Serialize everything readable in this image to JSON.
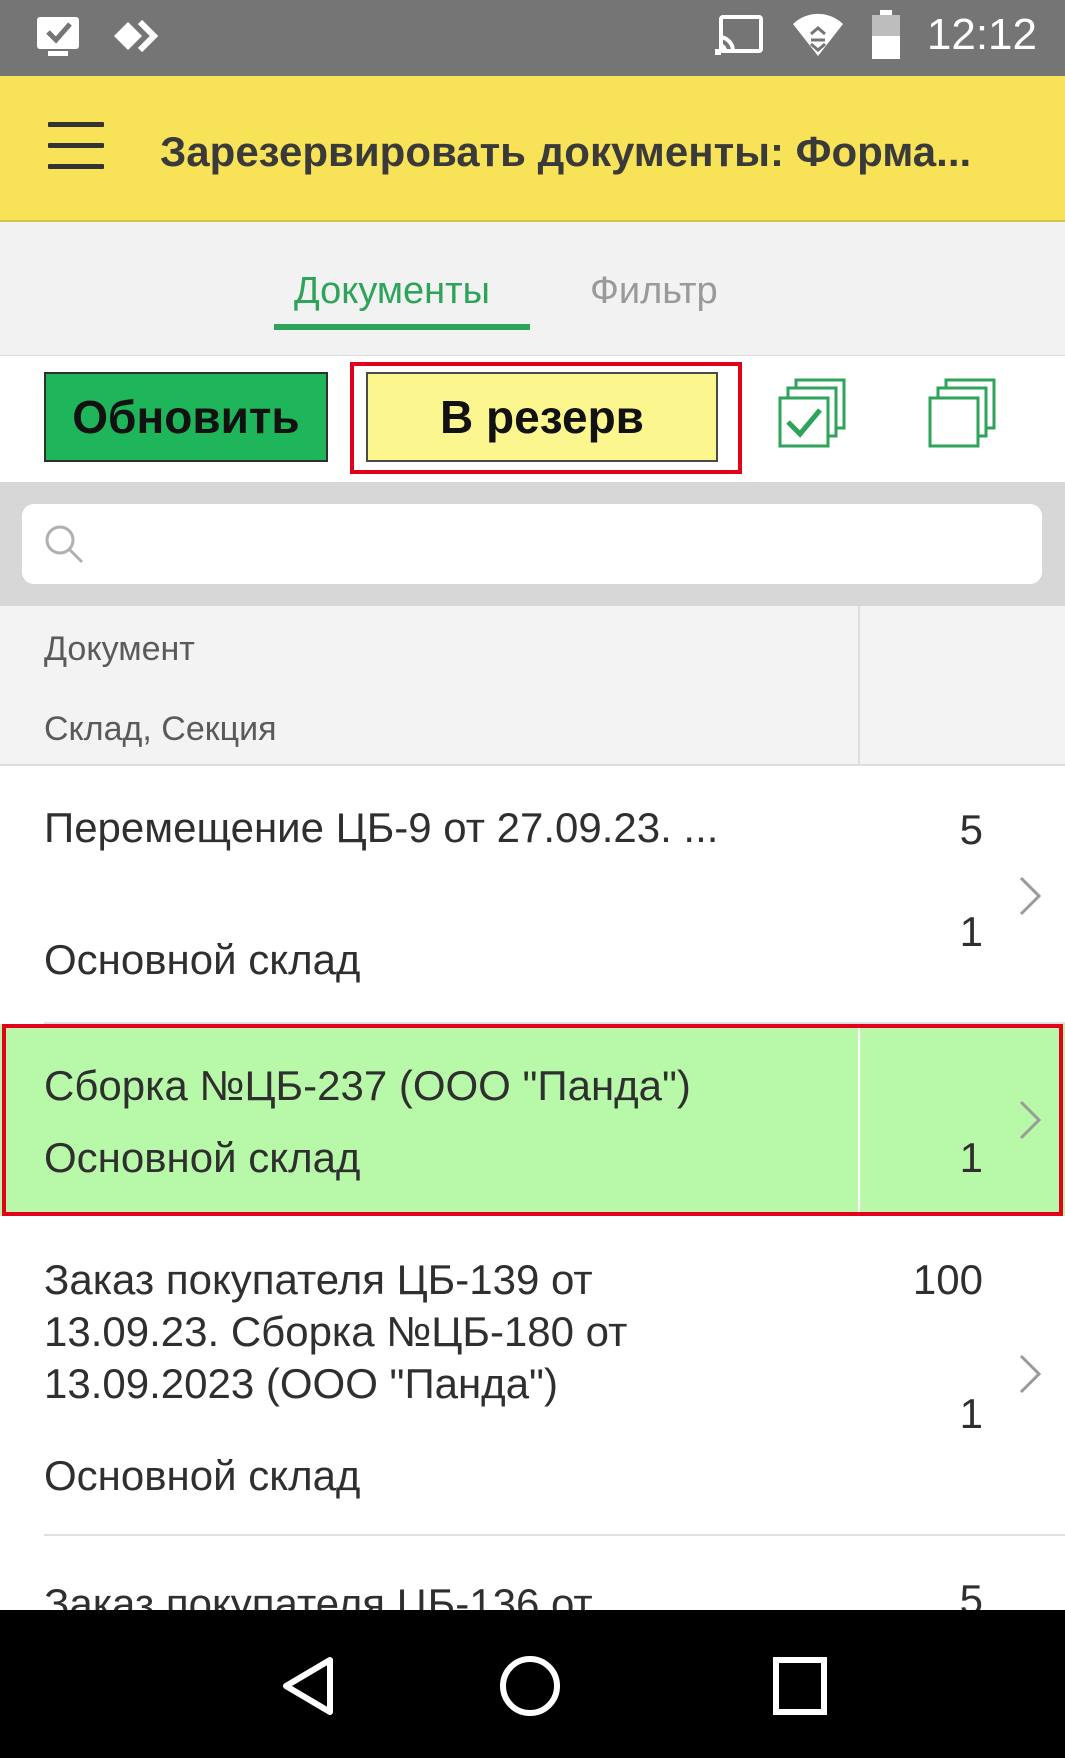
{
  "status_bar": {
    "time": "12:12"
  },
  "header": {
    "title": "Зарезервировать документы: Форма..."
  },
  "tabs": [
    {
      "label": "Документы",
      "active": true
    },
    {
      "label": "Фильтр",
      "active": false
    }
  ],
  "toolbar": {
    "refresh_label": "Обновить",
    "reserve_label": "В резерв"
  },
  "search": {
    "value": "",
    "placeholder": ""
  },
  "table": {
    "headers": {
      "line1": "Документ",
      "line2": "Склад, Секция"
    },
    "rows": [
      {
        "document": "Перемещение ЦБ-9 от 27.09.23. ...",
        "warehouse": "Основной склад",
        "qty_top": "5",
        "qty_bottom": "1",
        "selected": false
      },
      {
        "document": "Сборка №ЦБ-237 (ООО \"Панда\")",
        "warehouse": "Основной склад",
        "qty_top": "",
        "qty_bottom": "1",
        "selected": true
      },
      {
        "document": "Заказ покупателя ЦБ-139 от 13.09.23. Сборка №ЦБ-180 от 13.09.2023 (ООО \"Панда\")",
        "document_lines": [
          "Заказ покупателя ЦБ-139 от",
          "13.09.23. Сборка №ЦБ-180 от",
          "13.09.2023 (ООО \"Панда\")"
        ],
        "warehouse": "Основной склад",
        "qty_top": "100",
        "qty_bottom": "1",
        "selected": false
      },
      {
        "document": "Заказ покупателя ЦБ-136 от",
        "qty_top": "5",
        "selected": false
      }
    ]
  },
  "colors": {
    "title_bar": "#f7e258",
    "accent_green": "#2ea35a",
    "refresh_button": "#1fb65b",
    "reserve_button": "#fbf68d",
    "selected_row": "#b7f8a9",
    "highlight_red": "#e3001b"
  },
  "icons": {
    "status_left": [
      "checkbox-notification-icon",
      "app-diamond-icon"
    ],
    "status_right": [
      "cast-icon",
      "wifi-icon",
      "battery-icon"
    ],
    "toolbar": [
      "check-all-icon",
      "uncheck-all-icon"
    ],
    "nav": [
      "back-icon",
      "home-icon",
      "recent-apps-icon"
    ]
  }
}
